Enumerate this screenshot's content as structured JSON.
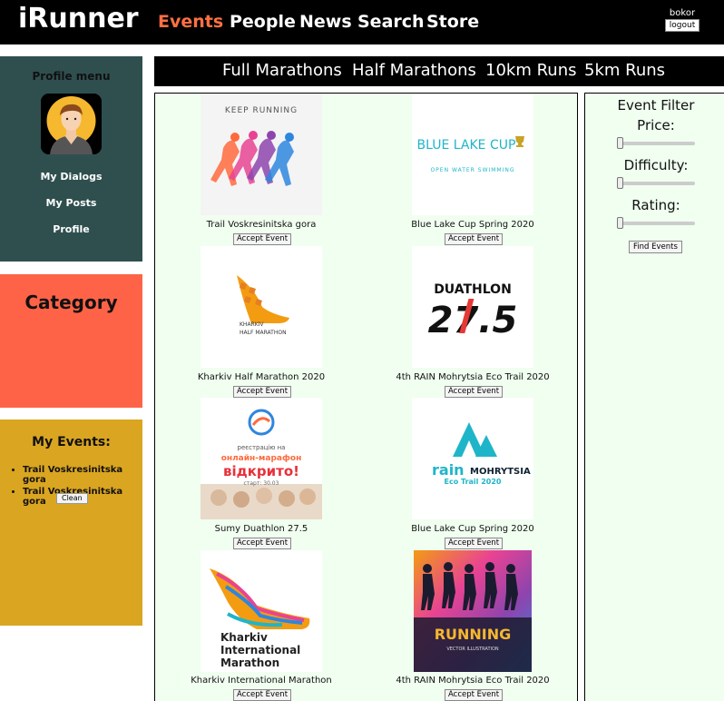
{
  "app": {
    "title": "iRunner"
  },
  "nav": {
    "items": [
      "Events",
      "People",
      "News",
      "Search",
      "Store"
    ],
    "active": "Events"
  },
  "user": {
    "name": "bokor",
    "logout_label": "logout"
  },
  "profile_menu": {
    "title": "Profile menu",
    "items": [
      "My Dialogs",
      "My Posts",
      "Profile"
    ]
  },
  "category": {
    "title": "Category"
  },
  "my_events": {
    "title": "My Events:",
    "items": [
      "Trail Voskresinitska gora",
      "Trail Voskresinitska gora"
    ],
    "clean_label": "Clean"
  },
  "tabs": [
    "Full Marathons",
    "Half Marathons",
    "10km Runs",
    "5km Runs"
  ],
  "events": [
    {
      "name": "Trail Voskresinitska gora",
      "accept_label": "Accept Event",
      "image_text": "KEEP RUNNING"
    },
    {
      "name": "Blue Lake Cup Spring 2020",
      "accept_label": "Accept Event",
      "image_text": "BLUE LAKE CUP",
      "image_subtext": "OPEN WATER SWIMMING"
    },
    {
      "name": "Kharkiv Half Marathon 2020",
      "accept_label": "Accept Event",
      "image_text": "KHARKIV",
      "image_subtext": "HALF MARATHON"
    },
    {
      "name": "4th RAIN Mohrytsia Eco Trail 2020",
      "accept_label": "Accept Event",
      "image_text": "DUATHLON",
      "image_subtext": "27.5"
    },
    {
      "name": "Sumy Duathlon 27.5",
      "accept_label": "Accept Event",
      "image_text": "реєстрацію на",
      "image_subtext": "онлайн-марафон",
      "image_big": "відкрито!",
      "image_small": "старт: 30.03"
    },
    {
      "name": "Blue Lake Cup Spring 2020",
      "accept_label": "Accept Event",
      "image_text": "rain",
      "image_subtext": "MOHRYTSIA",
      "image_small": "Eco Trail 2020"
    },
    {
      "name": "Kharkiv International Marathon",
      "accept_label": "Accept Event",
      "image_text": "Kharkiv",
      "image_subtext": "International",
      "image_big": "Marathon"
    },
    {
      "name": "4th RAIN Mohrytsia Eco Trail 2020",
      "accept_label": "Accept Event",
      "image_text": "RUNNING",
      "image_subtext": "VECTOR ILLUSTRATION"
    }
  ],
  "filter": {
    "title": "Event Filter",
    "price_label": "Price:",
    "difficulty_label": "Difficulty:",
    "rating_label": "Rating:",
    "find_label": "Find Events",
    "price_value": 0,
    "difficulty_value": 0,
    "rating_value": 0
  },
  "colors": {
    "accent": "#ff7043",
    "profile_bg": "#2f4f4f",
    "category_bg": "#ff6347",
    "my_events_bg": "#daa520",
    "panel_bg": "#f0fff0"
  }
}
